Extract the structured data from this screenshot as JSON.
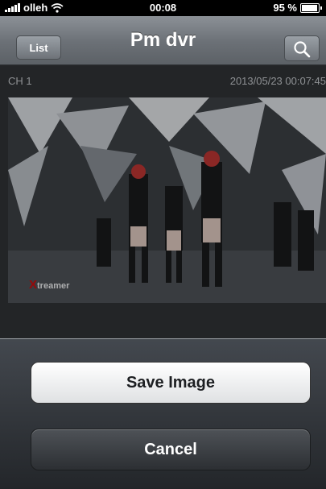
{
  "status_bar": {
    "carrier": "olleh",
    "time": "00:08",
    "battery_text": "95 %",
    "battery_level": 0.95
  },
  "nav": {
    "title": "Pm dvr",
    "list_label": "List"
  },
  "camera": {
    "channel": "CH 1",
    "timestamp": "2013/05/23 00:07:45"
  },
  "video": {
    "logo_letter": "X",
    "logo_rest": "treamer"
  },
  "action_sheet": {
    "save_label": "Save Image",
    "cancel_label": "Cancel"
  }
}
